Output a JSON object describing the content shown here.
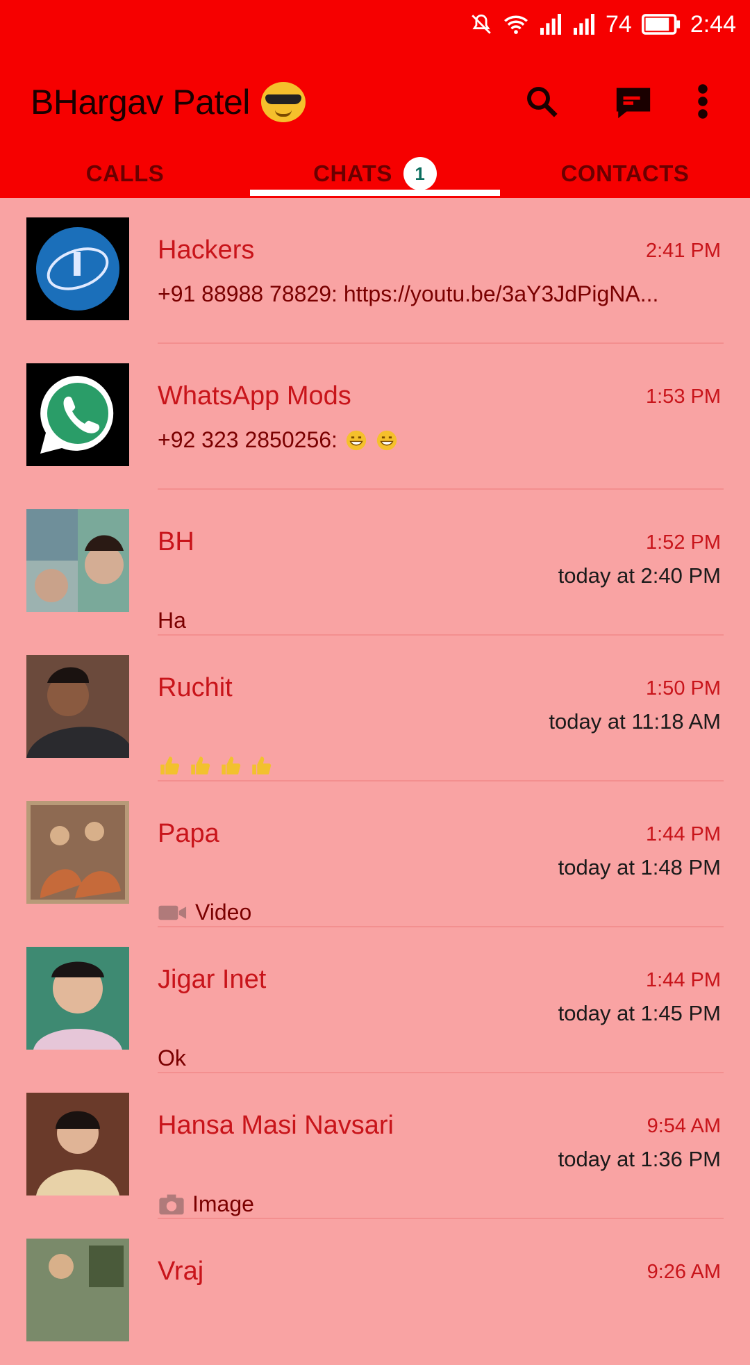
{
  "status_bar": {
    "battery": "74",
    "time": "2:44"
  },
  "app_bar": {
    "title": "BHargav Patel"
  },
  "tabs": [
    {
      "label": "CALLS"
    },
    {
      "label": "CHATS",
      "badge": "1"
    },
    {
      "label": "CONTACTS"
    }
  ],
  "chats": [
    {
      "name": "Hackers",
      "time": "2:41 PM",
      "message": "+91 88988 78829: https://youtu.be/3aY3JdPigNA..."
    },
    {
      "name": "WhatsApp Mods",
      "time": "1:53 PM",
      "message": "+92 323 2850256:"
    },
    {
      "name": "BH",
      "time": "1:52 PM",
      "seen": "today at 2:40 PM",
      "message": "Ha"
    },
    {
      "name": "Ruchit",
      "time": "1:50 PM",
      "seen": "today at 11:18 AM",
      "message": ""
    },
    {
      "name": "Papa",
      "time": "1:44 PM",
      "seen": "today at 1:48 PM",
      "message": "Video"
    },
    {
      "name": "Jigar Inet",
      "time": "1:44 PM",
      "seen": "today at 1:45 PM",
      "message": "Ok"
    },
    {
      "name": "Hansa Masi Navsari",
      "time": "9:54 AM",
      "seen": "today at 1:36 PM",
      "message": "Image"
    },
    {
      "name": "Vraj",
      "time": "9:26 AM"
    }
  ]
}
